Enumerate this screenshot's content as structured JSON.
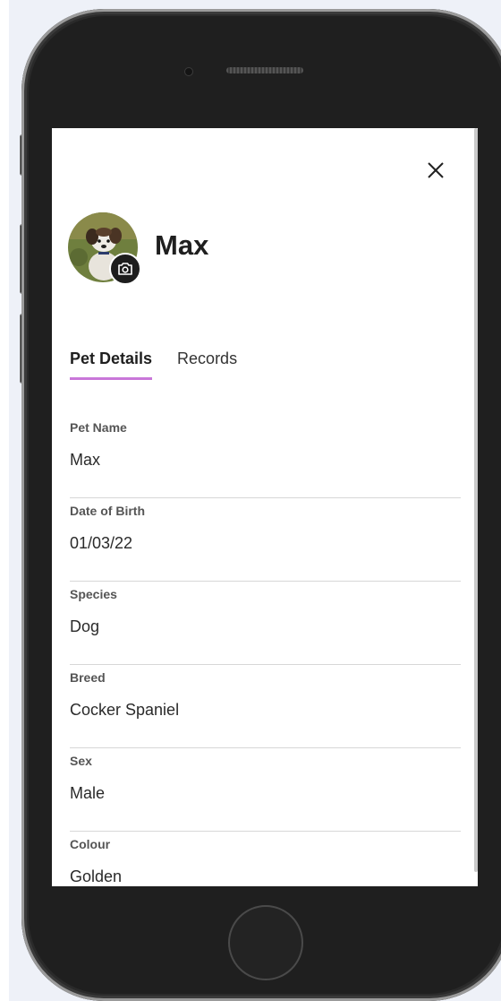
{
  "pet": {
    "name": "Max"
  },
  "tabs": [
    {
      "label": "Pet Details",
      "active": true
    },
    {
      "label": "Records",
      "active": false
    }
  ],
  "fields": [
    {
      "label": "Pet Name",
      "value": "Max"
    },
    {
      "label": "Date of Birth",
      "value": "01/03/22"
    },
    {
      "label": "Species",
      "value": "Dog"
    },
    {
      "label": "Breed",
      "value": "Cocker Spaniel"
    },
    {
      "label": "Sex",
      "value": "Male"
    },
    {
      "label": "Colour",
      "value": "Golden"
    }
  ],
  "icons": {
    "close": "close-icon",
    "camera": "camera-icon",
    "avatar": "pet-photo"
  },
  "colors": {
    "tab_underline": "#c977d9",
    "text_primary": "#1f1f1f",
    "divider": "#d7d7d7"
  }
}
